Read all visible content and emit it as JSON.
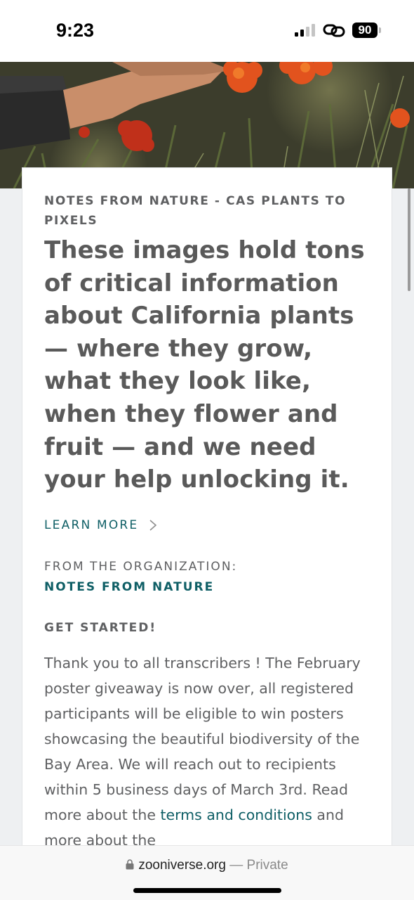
{
  "status_bar": {
    "time": "9:23",
    "battery_level": "90",
    "icons": [
      "signal-icon",
      "link-icon",
      "battery-icon"
    ]
  },
  "hero": {
    "image": "photo of a hand reaching toward orange wildflowers"
  },
  "card": {
    "eyebrow": "NOTES FROM NATURE - CAS PLANTS TO PIXELS",
    "headline": "These images hold tons of critical information about California plants — where they grow, what they look like, when they flower and fruit — and we need your help unlocking it.",
    "learn_more": "LEARN MORE",
    "org_label": "FROM THE ORGANIZATION:",
    "org_name": "NOTES FROM NATURE",
    "section_title": "GET STARTED!",
    "body_text_1": "Thank you to all transcribers ! The February poster giveaway is now over, all registered participants will be eligible to win posters showcasing the beautiful biodiversity of the Bay Area. We will reach out to recipients within 5 business days of March 3rd. Read more about the ",
    "body_link": "terms and conditions",
    "body_text_2": " and more about the"
  },
  "browser": {
    "domain": "zooniverse.org",
    "separator": " — ",
    "mode": "Private"
  },
  "colors": {
    "accent": "#0f5f66",
    "text": "#5f6062",
    "background": "#eef0f2"
  }
}
